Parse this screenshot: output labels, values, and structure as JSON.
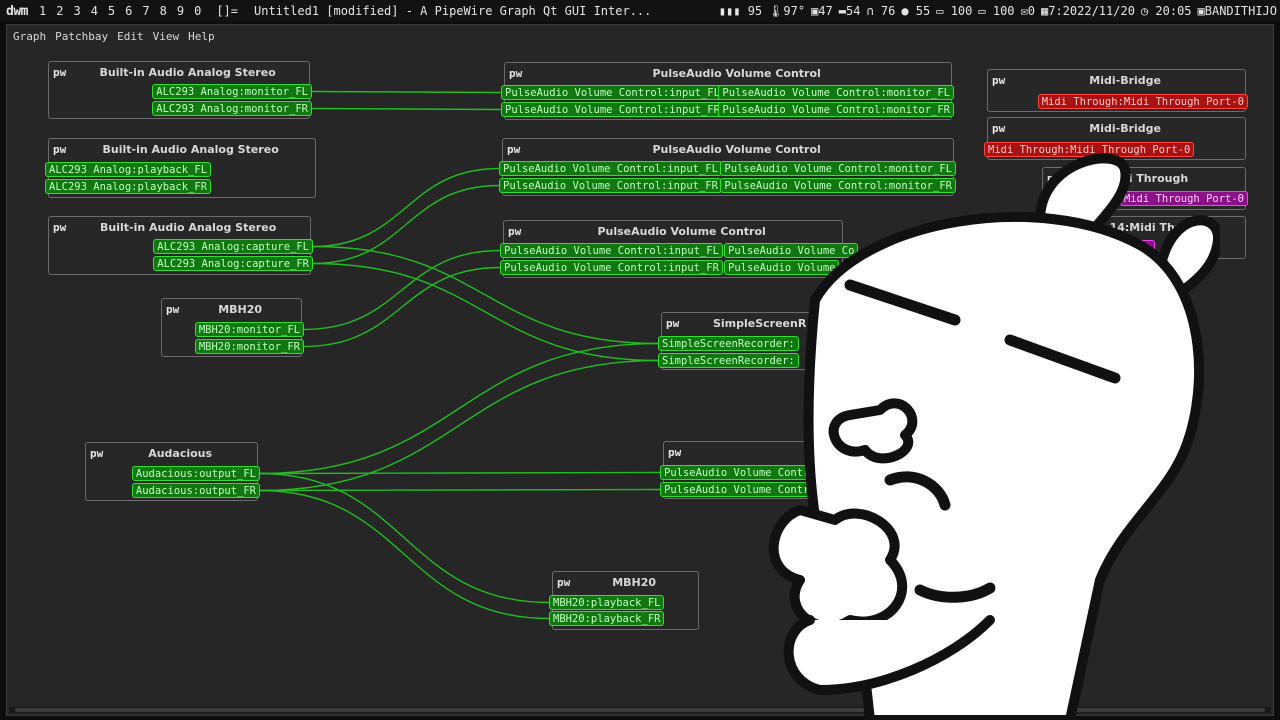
{
  "topbar": {
    "logo": "dwm",
    "tags": [
      "1",
      "2",
      "3",
      "4",
      "5",
      "6",
      "7",
      "8",
      "9",
      "0"
    ],
    "layout": "[]=",
    "window_title": "Untitled1 [modified] - A PipeWire Graph Qt GUI Inter...",
    "stats": {
      "cpu": "95",
      "temp": "97°",
      "mem": "47",
      "disk": "54",
      "headphones": "76",
      "mic": "55",
      "battery1": "100",
      "battery2": "100",
      "mail": "0",
      "date": "7:2022/11/20",
      "time": "20:05",
      "user": "BANDITHIJO"
    }
  },
  "menu": [
    "Graph",
    "Patchbay",
    "Edit",
    "View",
    "Help"
  ],
  "nodes": [
    {
      "id": "n1",
      "pw": "pw",
      "name": "Built-in Audio Analog Stereo",
      "ports": [
        "ALC293 Analog:monitor_FL",
        "ALC293 Analog:monitor_FR"
      ]
    },
    {
      "id": "n2",
      "pw": "pw",
      "name": "Built-in Audio Analog Stereo",
      "ports": [
        "ALC293 Analog:playback_FL",
        "ALC293 Analog:playback_FR"
      ]
    },
    {
      "id": "n3",
      "pw": "pw",
      "name": "Built-in Audio Analog Stereo",
      "ports": [
        "ALC293 Analog:capture_FL",
        "ALC293 Analog:capture_FR"
      ]
    },
    {
      "id": "n4",
      "pw": "pw",
      "name": "MBH20",
      "ports": [
        "MBH20:monitor_FL",
        "MBH20:monitor_FR"
      ]
    },
    {
      "id": "n5",
      "pw": "pw",
      "name": "Audacious",
      "ports": [
        "Audacious:output_FL",
        "Audacious:output_FR"
      ]
    },
    {
      "id": "n6",
      "pw": "pw",
      "name": "PulseAudio Volume Control",
      "ports": [
        "PulseAudio Volume Control:input_FL",
        "PulseAudio Volume Control:input_FR",
        "PulseAudio Volume Control:monitor_FL",
        "PulseAudio Volume Control:monitor_FR"
      ]
    },
    {
      "id": "n7",
      "pw": "pw",
      "name": "PulseAudio Volume Control",
      "ports": [
        "PulseAudio Volume Control:input_FL",
        "PulseAudio Volume Control:input_FR",
        "PulseAudio Volume Control:monitor_FL",
        "PulseAudio Volume Control:monitor_FR"
      ]
    },
    {
      "id": "n8",
      "pw": "pw",
      "name": "PulseAudio Volume Control",
      "ports": [
        "PulseAudio Volume Control:input_FL",
        "PulseAudio Volume Control:input_FR",
        "PulseAudio Volume Co",
        "PulseAudio Volume"
      ]
    },
    {
      "id": "n9",
      "pw": "pw",
      "name": "SimpleScreenR",
      "ports": [
        "SimpleScreenRecorder:",
        "SimpleScreenRecorder:"
      ]
    },
    {
      "id": "n10",
      "pw": "pw",
      "name": "",
      "ports": [
        "PulseAudio Volume Control",
        "PulseAudio Volume Contr"
      ]
    },
    {
      "id": "n11",
      "pw": "pw",
      "name": "MBH20",
      "ports": [
        "MBH20:playback_FL",
        "MBH20:playback_FR"
      ]
    },
    {
      "id": "n12",
      "pw": "pw",
      "name": "Midi-Bridge",
      "ports": [
        "Midi Through:Midi Through Port-0"
      ]
    },
    {
      "id": "n13",
      "pw": "pw",
      "name": "Midi-Bridge",
      "ports": [
        "Midi Through:Midi Through Port-0"
      ]
    },
    {
      "id": "n14",
      "pw": "pw",
      "name": "idi Through",
      "ports": [
        "Midi Through Port-0"
      ]
    },
    {
      "id": "n15",
      "pw": "pw",
      "name": "14:Midi Throu",
      "ports": [
        "gh Port"
      ]
    }
  ],
  "colors": {
    "audio_port": "#117711",
    "audio_border": "#33dd33",
    "midi_port": "#aa1111",
    "midi_border": "#ff4444",
    "wire": "#22bb22",
    "background": "#262626"
  }
}
